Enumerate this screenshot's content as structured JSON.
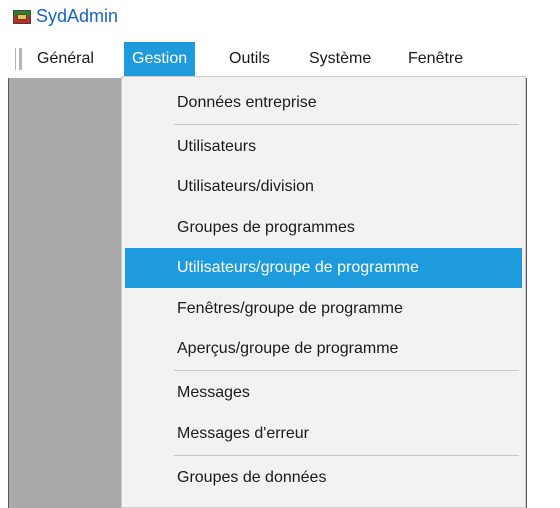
{
  "window": {
    "title": "SydAdmin",
    "icon": "app-icon"
  },
  "menubar": {
    "items": [
      {
        "label": "Général"
      },
      {
        "label": "Gestion",
        "active": true
      },
      {
        "label": "Outils"
      },
      {
        "label": "Système"
      },
      {
        "label": "Fenêtre"
      }
    ]
  },
  "dropdown": {
    "items": [
      {
        "label": "Données entreprise"
      },
      {
        "label": "Utilisateurs"
      },
      {
        "label": "Utilisateurs/division"
      },
      {
        "label": "Groupes de programmes"
      },
      {
        "label": "Utilisateurs/groupe de programme",
        "highlighted": true
      },
      {
        "label": "Fenêtres/groupe de programme"
      },
      {
        "label": "Aperçus/groupe de programme"
      },
      {
        "label": "Messages"
      },
      {
        "label": "Messages d'erreur"
      },
      {
        "label": "Groupes de données"
      }
    ]
  },
  "colors": {
    "highlight": "#1e9bdd",
    "title": "#1565c0",
    "workspace": "#a9a9a9",
    "menu_bg": "#f2f2f2"
  }
}
